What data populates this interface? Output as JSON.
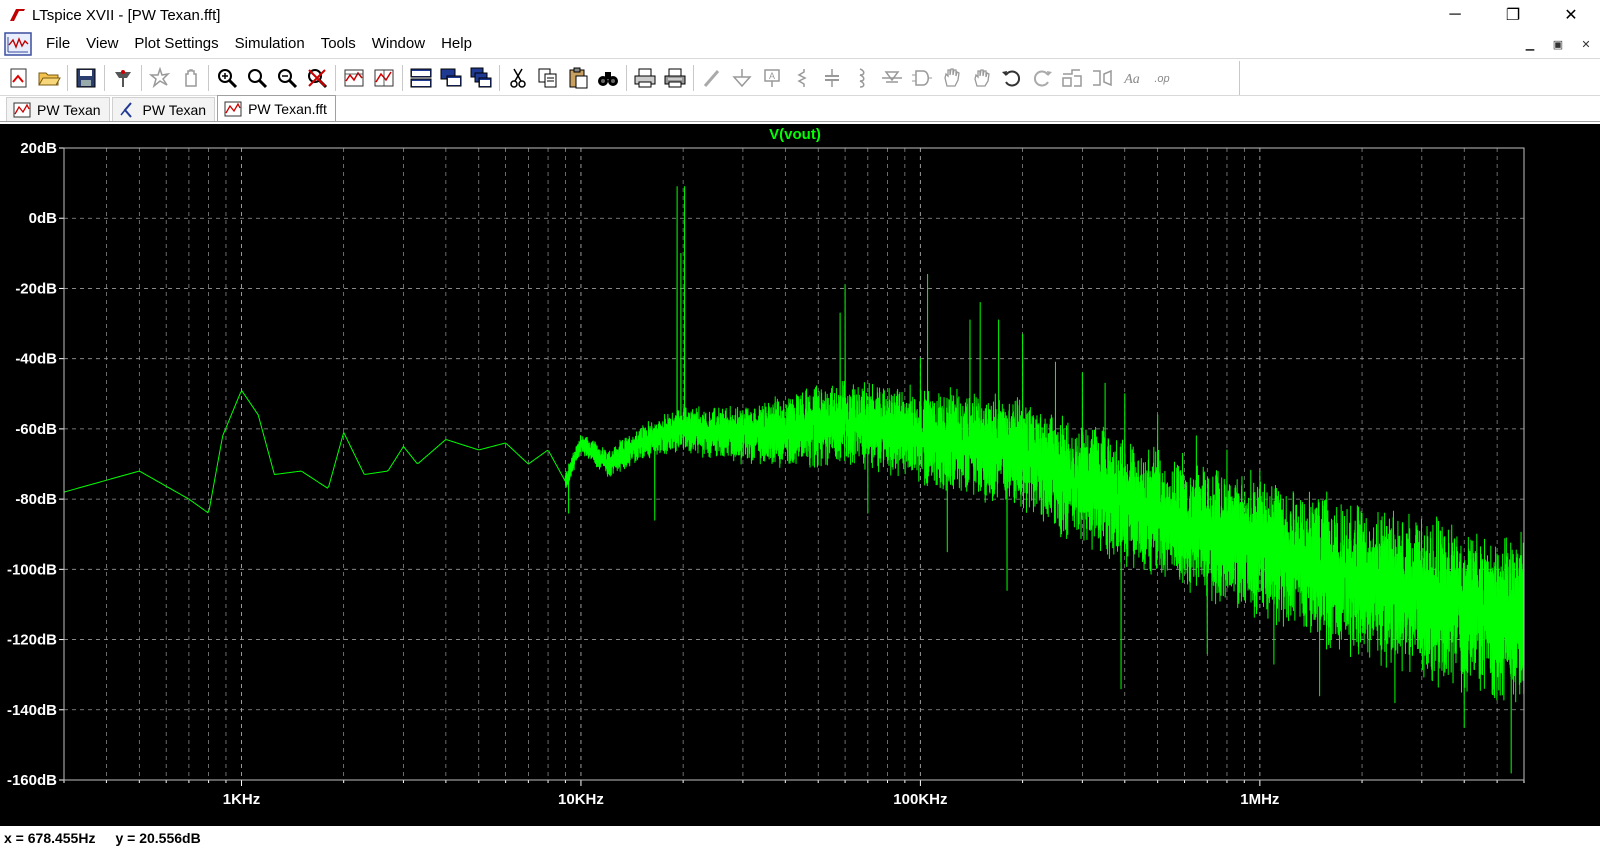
{
  "window": {
    "title": "LTspice XVII - [PW Texan.fft]",
    "controls": {
      "minimize": "─",
      "maximize": "❐",
      "close": "✕"
    }
  },
  "menu": {
    "items": [
      {
        "label": "File"
      },
      {
        "label": "View"
      },
      {
        "label": "Plot Settings"
      },
      {
        "label": "Simulation"
      },
      {
        "label": "Tools"
      },
      {
        "label": "Window"
      },
      {
        "label": "Help"
      }
    ],
    "mdi_controls": {
      "minimize": "▁",
      "restore": "▣",
      "close": "✕"
    }
  },
  "toolbar": {
    "icons": [
      "new-schematic-icon",
      "open-icon",
      "save-icon",
      "control-panel-icon",
      "run-icon",
      "halt-icon",
      "zoom-in-icon",
      "zoom-pan-icon",
      "zoom-out-icon",
      "zoom-fit-icon",
      "autorange-icon",
      "waveform-icon",
      "tile-horizontal-icon",
      "tile-vertical-icon",
      "cascade-icon",
      "cut-icon",
      "copy-icon",
      "paste-icon",
      "find-icon",
      "print-icon",
      "print-setup-icon",
      "wire-icon",
      "ground-icon",
      "label-icon",
      "resistor-icon",
      "capacitor-icon",
      "inductor-icon",
      "diode-icon",
      "component-icon",
      "move-icon",
      "drag-icon",
      "undo-icon",
      "redo-icon",
      "rotate-icon",
      "mirror-icon",
      "text-icon",
      "spice-directive-icon"
    ],
    "spice_directive_text": ".op",
    "text_glyph": "Aa"
  },
  "tabs": [
    {
      "label": "PW Texan",
      "icon": "waveform-icon",
      "active": false
    },
    {
      "label": "PW Texan",
      "icon": "schematic-icon",
      "active": false
    },
    {
      "label": "PW Texan.fft",
      "icon": "waveform-icon",
      "active": true
    }
  ],
  "status": {
    "x_readout": "x = 678.455Hz",
    "y_readout": "y = 20.556dB"
  },
  "colors": {
    "trace": "#00ff00",
    "background": "#000000",
    "grid": "#9a9a9a",
    "axis_text": "#ffffff"
  },
  "chart_data": {
    "type": "line",
    "title": "V(vout)",
    "x_scale": "log",
    "xlim": [
      300,
      6000000
    ],
    "ylim": [
      -160,
      20
    ],
    "y_ticks": [
      20,
      0,
      -20,
      -40,
      -60,
      -80,
      -100,
      -120,
      -140,
      -160
    ],
    "y_tick_labels": [
      "20dB",
      "0dB",
      "-20dB",
      "-40dB",
      "-60dB",
      "-80dB",
      "-100dB",
      "-120dB",
      "-140dB",
      "-160dB"
    ],
    "x_ticks": [
      1000,
      10000,
      100000,
      1000000
    ],
    "x_tick_labels": [
      "1KHz",
      "10KHz",
      "100KHz",
      "1MHz"
    ],
    "grid": true,
    "series": [
      {
        "color": "#00ff00",
        "envelope": [
          [
            300,
            -78
          ],
          [
            500,
            -72
          ],
          [
            700,
            -80
          ],
          [
            800,
            -84
          ],
          [
            880,
            -62
          ],
          [
            1000,
            -49
          ],
          [
            1120,
            -56
          ],
          [
            1250,
            -73
          ],
          [
            1500,
            -72
          ],
          [
            1800,
            -77
          ],
          [
            2000,
            -61
          ],
          [
            2300,
            -73
          ],
          [
            2700,
            -72
          ],
          [
            3000,
            -65
          ],
          [
            3300,
            -70
          ],
          [
            4000,
            -63
          ],
          [
            5000,
            -66
          ],
          [
            6000,
            -64
          ],
          [
            7000,
            -70
          ],
          [
            8000,
            -66
          ],
          [
            9000,
            -75
          ],
          [
            10000,
            -64
          ],
          [
            12000,
            -70
          ],
          [
            15000,
            -64
          ],
          [
            20000,
            -60
          ],
          [
            30000,
            -62
          ],
          [
            60000,
            -58
          ],
          [
            100000,
            -62
          ],
          [
            200000,
            -67
          ],
          [
            300000,
            -76
          ],
          [
            500000,
            -84
          ],
          [
            1000000,
            -94
          ],
          [
            2000000,
            -104
          ],
          [
            4000000,
            -111
          ],
          [
            6000000,
            -114
          ]
        ],
        "noise_band_db": [
          [
            10000,
            5
          ],
          [
            20000,
            10
          ],
          [
            50000,
            18
          ],
          [
            100000,
            22
          ],
          [
            300000,
            28
          ],
          [
            1000000,
            32
          ],
          [
            6000000,
            40
          ]
        ],
        "peaks": [
          [
            19200,
            9
          ],
          [
            20200,
            9
          ],
          [
            19700,
            -10
          ],
          [
            60000,
            -19
          ],
          [
            58000,
            -27
          ],
          [
            100000,
            -40
          ],
          [
            105000,
            -16
          ],
          [
            140000,
            -29
          ],
          [
            150000,
            -24
          ],
          [
            170000,
            -29
          ],
          [
            200000,
            -33
          ],
          [
            250000,
            -41
          ],
          [
            300000,
            -44
          ],
          [
            350000,
            -47
          ],
          [
            400000,
            -50
          ],
          [
            500000,
            -56
          ],
          [
            650000,
            -62
          ],
          [
            800000,
            -66
          ],
          [
            1000000,
            -72
          ],
          [
            1400000,
            -78
          ],
          [
            2000000,
            -84
          ]
        ],
        "dips": [
          [
            9200,
            -84
          ],
          [
            16500,
            -86
          ],
          [
            70000,
            -84
          ],
          [
            120000,
            -95
          ],
          [
            180000,
            -106
          ],
          [
            390000,
            -134
          ],
          [
            700000,
            -124
          ],
          [
            1100000,
            -127
          ],
          [
            1500000,
            -136
          ],
          [
            2500000,
            -138
          ],
          [
            4000000,
            -145
          ],
          [
            5500000,
            -158
          ]
        ]
      }
    ]
  }
}
